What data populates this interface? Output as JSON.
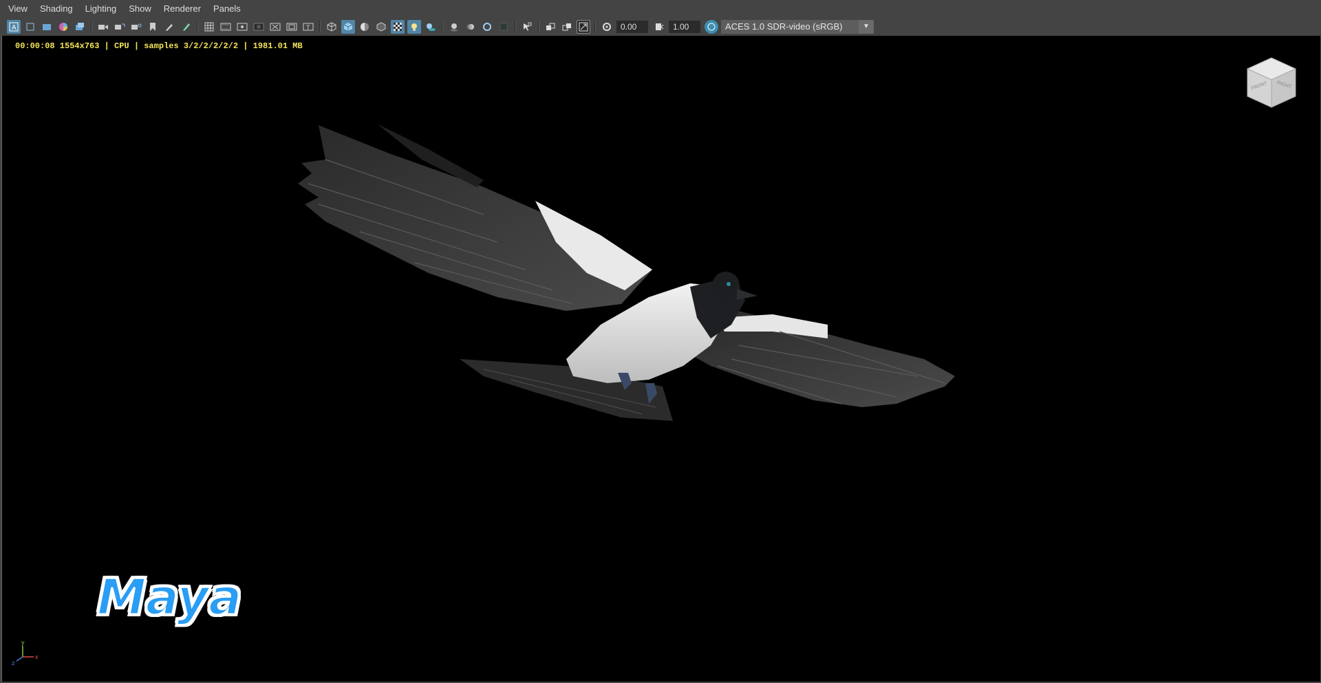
{
  "menu": {
    "items": [
      "View",
      "Shading",
      "Lighting",
      "Show",
      "Renderer",
      "Panels"
    ]
  },
  "toolbar": {
    "exposure_value": "0.00",
    "gamma_value": "1.00",
    "color_space": "ACES 1.0 SDR-video (sRGB)",
    "icons": [
      "select-camera-icon",
      "camera-attributes-icon",
      "film-gate-icon",
      "color-wheel-icon",
      "image-plane-icon",
      "bookmark-camera-icon",
      "camera-track-icon",
      "camera-dolly-icon",
      "camera-bookmark-icon",
      "grease-pencil-icon",
      "paint-icon",
      "grid-icon",
      "film-gate-toggle-icon",
      "resolution-gate-icon",
      "gate-mask-icon",
      "field-chart-icon",
      "safe-action-icon",
      "safe-title-icon",
      "wireframe-icon",
      "smooth-shade-icon",
      "shade-wireframe-icon",
      "bounding-box-icon",
      "textured-icon",
      "use-lights-icon",
      "shadows-icon",
      "ambient-occlusion-icon",
      "motion-blur-icon",
      "anti-aliasing-icon",
      "depth-of-field-icon",
      "isolate-select-icon",
      "xray-icon",
      "xray-joints-icon",
      "xray-components-icon",
      "exposure-icon",
      "gamma-icon",
      "view-transform-icon"
    ]
  },
  "viewport": {
    "hud_text": "00:00:08 1554x763 | CPU | samples 3/2/2/2/2/2 | 1981.01 MB",
    "viewcube_front": "FRONT",
    "viewcube_right": "RIGHT",
    "logo_text": "Maya",
    "axis_y": "y",
    "axis_x": "x",
    "axis_z": "z"
  },
  "colors": {
    "accent": "#5285a6",
    "hud_text": "#f5e55a",
    "logo_fill": "#2a9df4",
    "viewport_bg": "#000000",
    "ui_bg": "#444444"
  }
}
